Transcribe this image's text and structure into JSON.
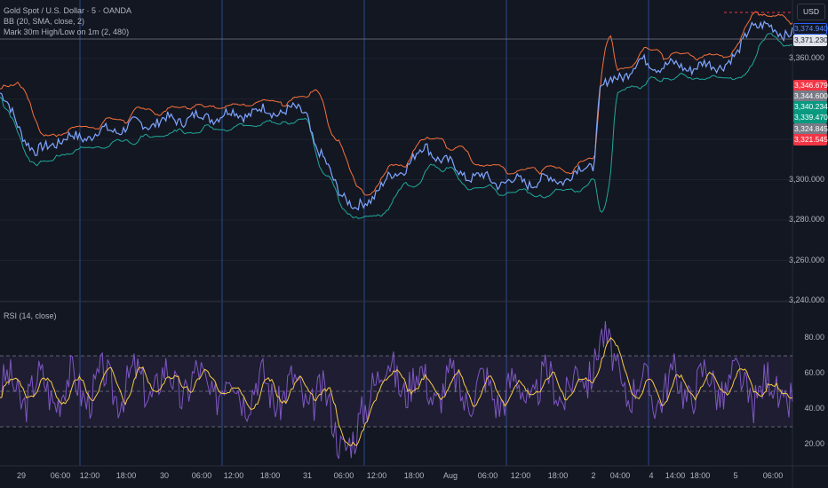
{
  "header": {
    "symbol": "Gold Spot / U.S. Dollar · 5 · OANDA",
    "indicator_bb": "BB (20, SMA, close, 2)",
    "indicator_mark": "Mark 30m High/Low on 1m (2, 480)",
    "rsi_label": "RSI (14, close)",
    "currency": "USD"
  },
  "price_tags": [
    {
      "text": "3,374.940",
      "bg": "#131722",
      "border": "#2962ff",
      "color": "#5b8cff"
    },
    {
      "text": "3,371.230",
      "bg": "#e0e3eb",
      "border": "#e0e3eb",
      "color": "#131722"
    },
    {
      "text": "3,346.679",
      "bg": "#f23645",
      "border": "#f23645",
      "color": "#ffffff"
    },
    {
      "text": "3,344.600",
      "bg": "#787b86",
      "border": "#787b86",
      "color": "#ffffff"
    },
    {
      "text": "3,340.234",
      "bg": "#089981",
      "border": "#089981",
      "color": "#ffffff"
    },
    {
      "text": "3,339.470",
      "bg": "#089981",
      "border": "#089981",
      "color": "#ffffff"
    },
    {
      "text": "3,324.845",
      "bg": "#787b86",
      "border": "#787b86",
      "color": "#ffffff"
    },
    {
      "text": "3,321.545",
      "bg": "#f23645",
      "border": "#f23645",
      "color": "#ffffff"
    }
  ],
  "chart_data": [
    {
      "type": "line",
      "title": "Gold Spot / U.S. Dollar · 5 · OANDA",
      "ylim": [
        3230,
        3385
      ],
      "yticks": [
        "3,360.000",
        "3,300.000",
        "3,280.000",
        "3,260.000",
        "3,240.000"
      ],
      "ytick_values": [
        3360,
        3300,
        3280,
        3260,
        3240
      ],
      "x": [
        0,
        4.5,
        6.7,
        10,
        17,
        22.5,
        28,
        33.6,
        38.7,
        39.8,
        42,
        44.8,
        48.2,
        53.8,
        58.3,
        62.8,
        67.3,
        71.7,
        74.9,
        75.7,
        77.4,
        80.7,
        85.2,
        89.7,
        93,
        94.7,
        97.5,
        100
      ],
      "series": [
        {
          "name": "Close",
          "values": [
            3343,
            3312,
            3319,
            3321,
            3327,
            3330,
            3332,
            3334,
            3334,
            3316,
            3301,
            3284,
            3297,
            3316,
            3303,
            3299,
            3299,
            3301,
            3308,
            3345,
            3349,
            3358,
            3356,
            3356,
            3360,
            3378,
            3374,
            3373
          ]
        }
      ],
      "colors": {
        "price": "#7fa6ff",
        "bb_upper": "#f7703a",
        "bb_lower": "#1fa89a",
        "last_line": "#787b86",
        "high_mark": "#f23645"
      }
    },
    {
      "type": "line",
      "title": "RSI (14, close)",
      "ylim": [
        10,
        92
      ],
      "yticks": [
        "80.00",
        "60.00",
        "40.00",
        "20.00"
      ],
      "ytick_values": [
        80,
        60,
        40,
        20
      ],
      "bands": [
        70,
        50,
        30
      ],
      "x": [
        0,
        10,
        20,
        30,
        40,
        44.8,
        47,
        55,
        65,
        74,
        75.7,
        77,
        80,
        90,
        100
      ],
      "series": [
        {
          "name": "RSI",
          "values": [
            50,
            52,
            55,
            53,
            48,
            15,
            62,
            52,
            50,
            55,
            86,
            65,
            50,
            55,
            48
          ]
        }
      ],
      "colors": {
        "rsi": "#7e57c2",
        "rsi_ma": "#f7c948",
        "band": "#7e57c2"
      }
    }
  ],
  "time_axis": [
    "29",
    "06:00",
    "12:00",
    "18:00",
    "30",
    "06:00",
    "12:00",
    "18:00",
    "31",
    "06:00",
    "12:00",
    "18:00",
    "Aug",
    "06:00",
    "12:00",
    "18:00",
    "2",
    "04:00",
    "4",
    "14:00",
    "18:00",
    "5",
    "06:00"
  ]
}
